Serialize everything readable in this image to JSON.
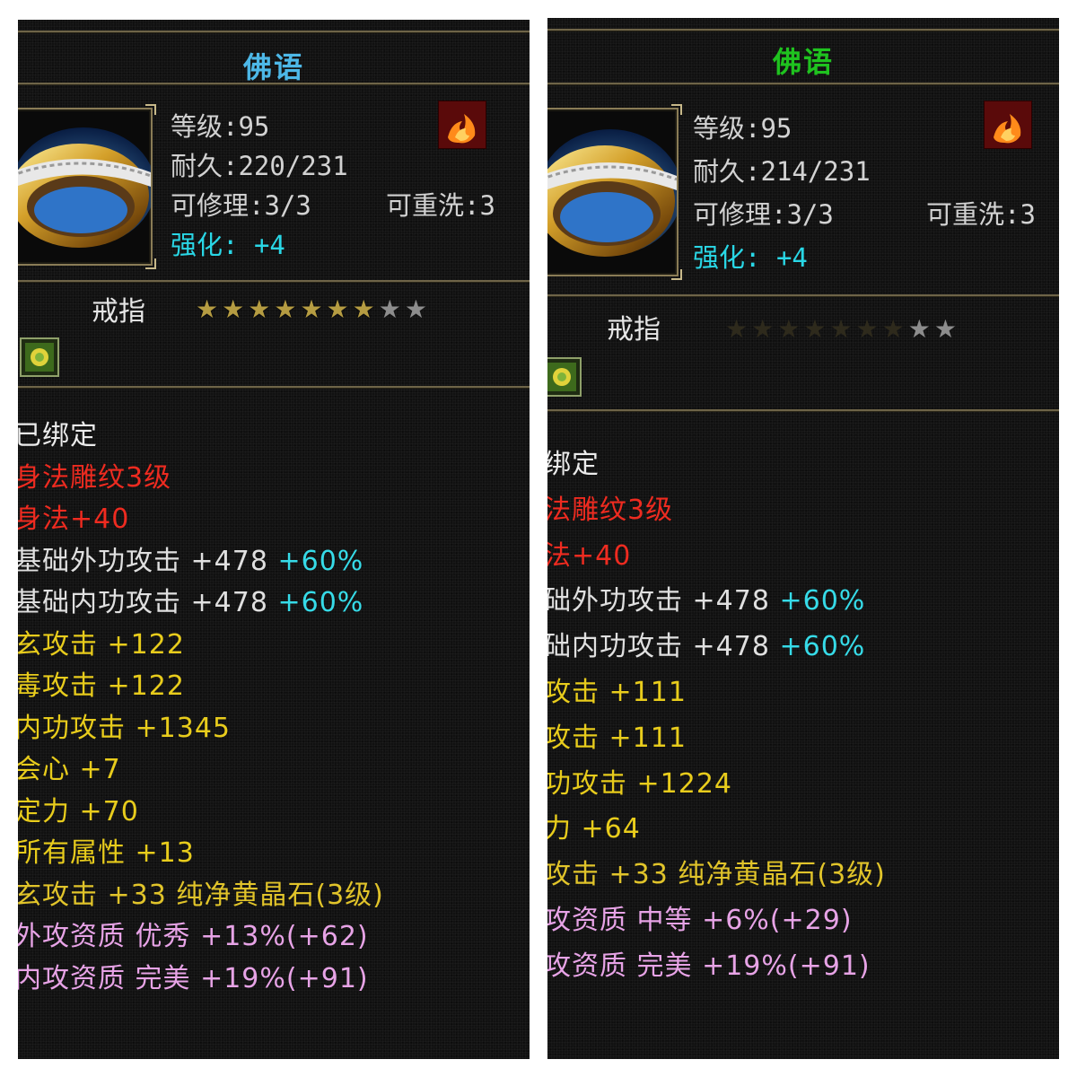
{
  "left": {
    "title": "佛语",
    "title_color": "#4db8e8",
    "level": "等级:95",
    "durability": "耐久:220/231",
    "repairable": "可修理:3/3",
    "rewash": "可重洗:3",
    "enhance_label": "强化:",
    "enhance_value": "+4",
    "item_type": "戒指",
    "stars_filled": 7,
    "stars_total": 9,
    "lines": [
      {
        "text": "已绑定",
        "color": "white"
      },
      {
        "text": "身法雕纹3级",
        "color": "red"
      },
      {
        "text": "身法+40",
        "color": "red"
      },
      {
        "text": "基础外功攻击 +478",
        "extra": " +60%",
        "color": "white2"
      },
      {
        "text": "基础内功攻击 +478",
        "extra": " +60%",
        "color": "white2"
      },
      {
        "text": "玄攻击 +122",
        "color": "yellow"
      },
      {
        "text": "毒攻击 +122",
        "color": "yellow"
      },
      {
        "text": "内功攻击 +1345",
        "color": "yellow"
      },
      {
        "text": "会心 +7",
        "color": "yellow"
      },
      {
        "text": "定力 +70",
        "color": "yellow"
      },
      {
        "text": "所有属性 +13",
        "color": "yellow"
      },
      {
        "text": "玄攻击 +33 纯净黄晶石(3级)",
        "color": "yellow2"
      },
      {
        "text": "外攻资质  优秀 +13%(+62)",
        "color": "pink"
      },
      {
        "text": "内攻资质  完美 +19%(+91)",
        "color": "pink"
      }
    ]
  },
  "right": {
    "title": "佛语",
    "title_color": "#1fc21f",
    "level": "等级:95",
    "durability": "耐久:214/231",
    "repairable": "可修理:3/3",
    "rewash": "可重洗:3",
    "enhance_label": "强化:",
    "enhance_value": "+4",
    "item_type": "戒指",
    "stars_filled": 7,
    "stars_total": 9,
    "lines": [
      {
        "text": "绑定",
        "color": "white"
      },
      {
        "text": "法雕纹3级",
        "color": "red"
      },
      {
        "text": "法+40",
        "color": "red"
      },
      {
        "text": "础外功攻击 +478",
        "extra": " +60%",
        "color": "white2"
      },
      {
        "text": "础内功攻击 +478",
        "extra": " +60%",
        "color": "white2"
      },
      {
        "text": "攻击 +111",
        "color": "yellow"
      },
      {
        "text": "攻击 +111",
        "color": "yellow"
      },
      {
        "text": "功攻击 +1224",
        "color": "yellow"
      },
      {
        "text": "力 +64",
        "color": "yellow"
      },
      {
        "text": "攻击 +33 纯净黄晶石(3级)",
        "color": "yellow2"
      },
      {
        "text": "攻资质  中等 +6%(+29)",
        "color": "pink"
      },
      {
        "text": "攻资质  完美 +19%(+91)",
        "color": "pink"
      }
    ]
  }
}
